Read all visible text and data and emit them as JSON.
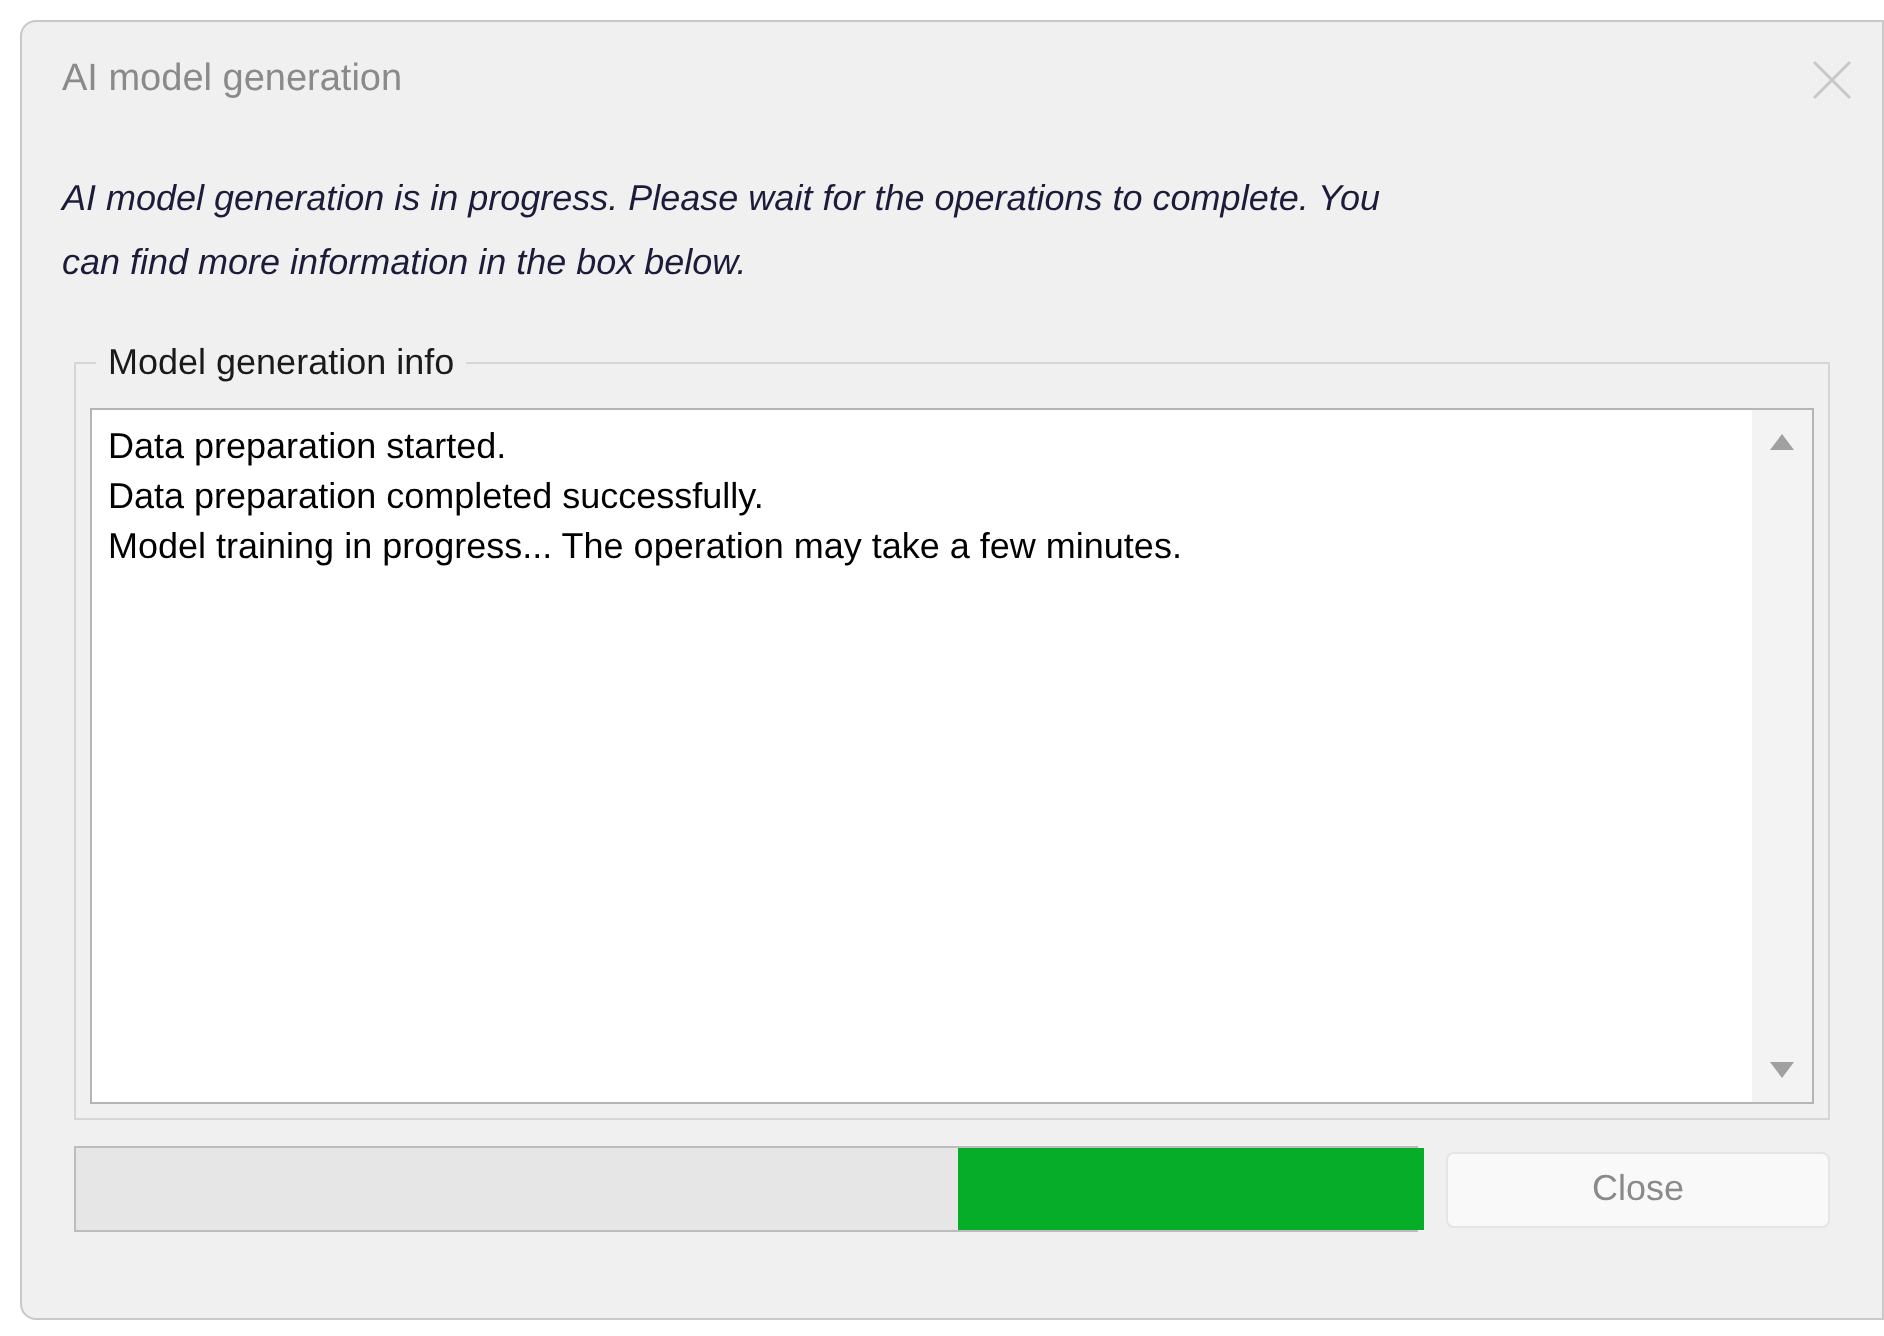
{
  "window": {
    "title": "AI model generation",
    "active": false
  },
  "message": "AI model generation is in progress. Please wait for the operations to complete. You can find more information in the box below.",
  "info_group": {
    "label": "Model generation info",
    "lines": [
      "Data preparation started.",
      "Data preparation completed successfully.",
      "Model training in progress... The operation may take a few minutes."
    ]
  },
  "progress": {
    "indeterminate": true
  },
  "buttons": [
    {
      "label": "Close",
      "disabled": true
    }
  ]
}
